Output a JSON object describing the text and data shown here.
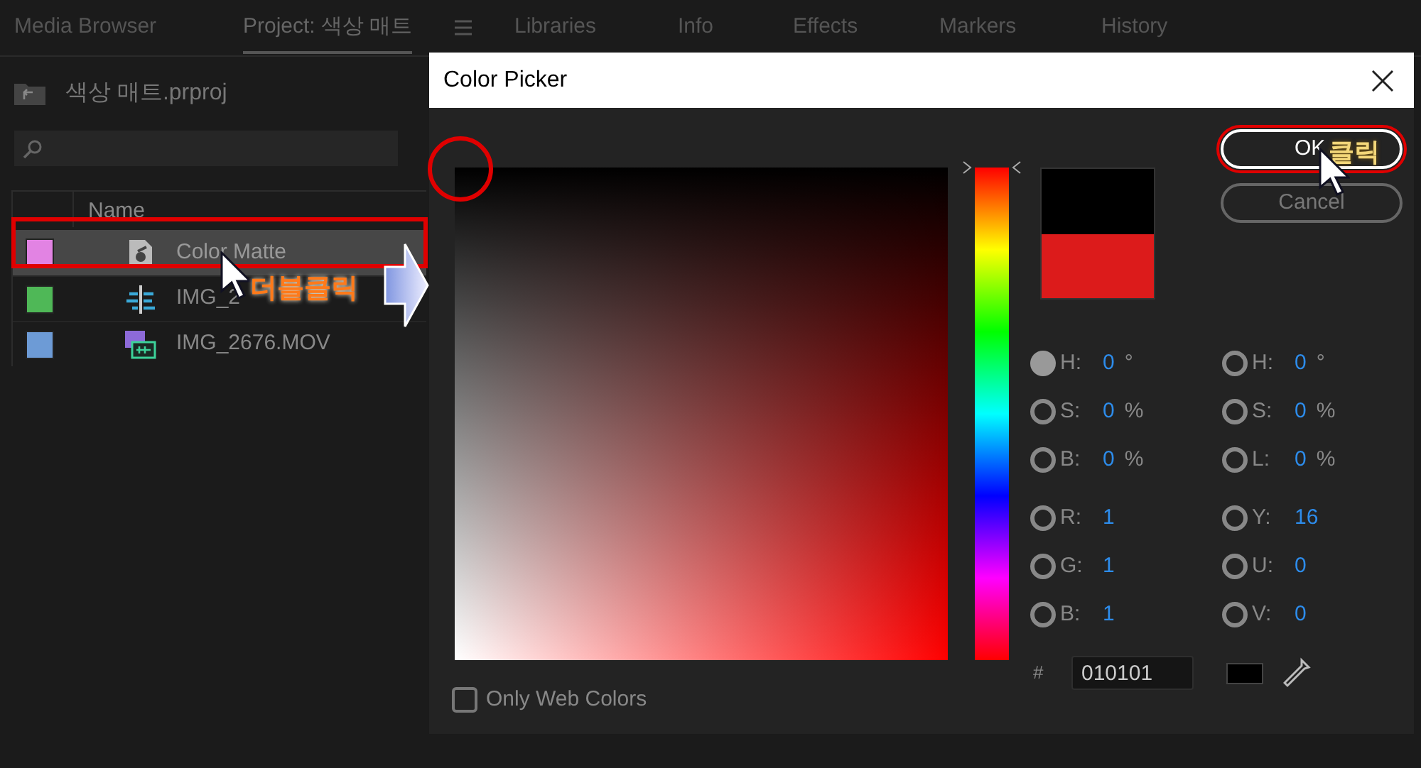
{
  "panel_tabs": [
    {
      "label": "Media Browser",
      "selected": false
    },
    {
      "label": "Project: 색상 매트",
      "selected": true
    },
    {
      "label": "Libraries",
      "selected": false
    },
    {
      "label": "Info",
      "selected": false
    },
    {
      "label": "Effects",
      "selected": false
    },
    {
      "label": "Markers",
      "selected": false
    },
    {
      "label": "History",
      "selected": false
    }
  ],
  "project": {
    "file_name": "색상 매트.prproj",
    "columns": [
      "Name"
    ],
    "items": [
      {
        "name": "Color Matte",
        "kind": "matte",
        "color": "#e283e3",
        "selected": true
      },
      {
        "name": "IMG_2",
        "kind": "sequence",
        "color": "#4fb857",
        "selected": false
      },
      {
        "name": "IMG_2676.MOV",
        "kind": "clip",
        "color": "#6d9bd6",
        "selected": false
      }
    ]
  },
  "dialog": {
    "title": "Color Picker",
    "ok": "OK",
    "cancel": "Cancel",
    "hsb_fields": [
      {
        "label": "H:",
        "value": "0",
        "unit": "°",
        "selected": true
      },
      {
        "label": "S:",
        "value": "0",
        "unit": "%",
        "selected": false
      },
      {
        "label": "B:",
        "value": "0",
        "unit": "%",
        "selected": false
      },
      {
        "label": "R:",
        "value": "1",
        "selected": false
      },
      {
        "label": "G:",
        "value": "1",
        "selected": false
      },
      {
        "label": "B:",
        "value": "1",
        "selected": false
      }
    ],
    "hsl_fields": [
      {
        "label": "H:",
        "value": "0",
        "unit": "°",
        "selected": false
      },
      {
        "label": "S:",
        "value": "0",
        "unit": "%",
        "selected": false
      },
      {
        "label": "L:",
        "value": "0",
        "unit": "%",
        "selected": false
      },
      {
        "label": "Y:",
        "value": "16",
        "selected": false
      },
      {
        "label": "U:",
        "value": "0",
        "selected": false
      },
      {
        "label": "V:",
        "value": "0",
        "selected": false
      }
    ],
    "hue_slider": {
      "level": 0
    },
    "hex_label": "#",
    "hex": "010101",
    "web_colors": {
      "label": "Only Web Colors",
      "checked": false
    }
  },
  "annotations": {
    "double_click_label": "더블클릭",
    "click_label": "클릭"
  }
}
